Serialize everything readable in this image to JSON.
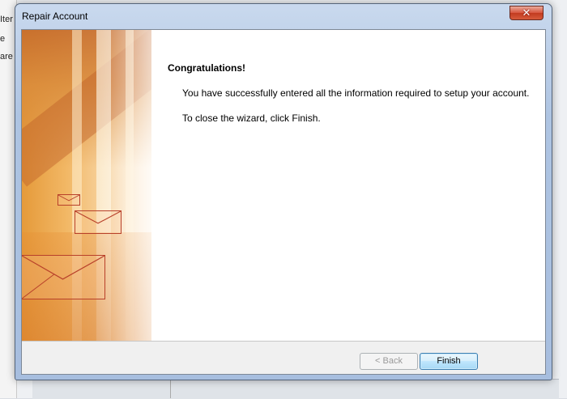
{
  "background": {
    "fragment_1": "Iter",
    "fragment_2": "e",
    "fragment_3": "are r"
  },
  "window": {
    "title": "Repair Account",
    "close_glyph": "✕"
  },
  "wizard": {
    "heading": "Congratulations!",
    "message_1": "You have successfully entered all the information required to setup your account.",
    "message_2": "To close the wizard, click Finish."
  },
  "buttons": {
    "back_label": "< Back",
    "back_enabled": false,
    "finish_label": "Finish"
  },
  "colors": {
    "close_button": "#c23a1f",
    "default_button_border": "#3c7fb1",
    "art_orange": "#e59a3a"
  },
  "icons": {
    "close": "close-icon",
    "side_art": "envelope-illustration"
  }
}
